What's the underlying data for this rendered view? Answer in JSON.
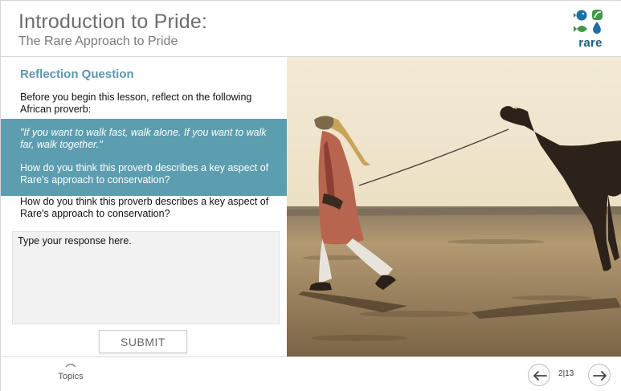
{
  "header": {
    "title": "Introduction to Pride:",
    "subtitle": "The Rare Approach to Pride",
    "logo_text": "rare"
  },
  "reflection": {
    "heading": "Reflection Question",
    "intro": "Before you begin this lesson, reflect on the following African proverb:",
    "quote": "\"If you want to walk fast, walk alone. If you want to walk far, walk together.\"",
    "highlight_question": "How do you think this proverb describes a key aspect of Rare's approach to conservation?",
    "question": "How do you think this proverb describes a key aspect of Rare's approach to conservation?",
    "response_placeholder": "Type your response here.",
    "response_value": "",
    "submit_label": "SUBMIT"
  },
  "footer": {
    "topics_label": "Topics",
    "page_current": "2",
    "page_separator": "|",
    "page_total": "13"
  },
  "colors": {
    "accent": "#5d9db0",
    "heading": "#5d98ad",
    "brand_blue": "#1b5f83",
    "brand_green": "#3f9a45"
  },
  "icons": {
    "topics": "chevron-up-icon",
    "prev": "arrow-left-icon",
    "next": "arrow-right-icon"
  }
}
